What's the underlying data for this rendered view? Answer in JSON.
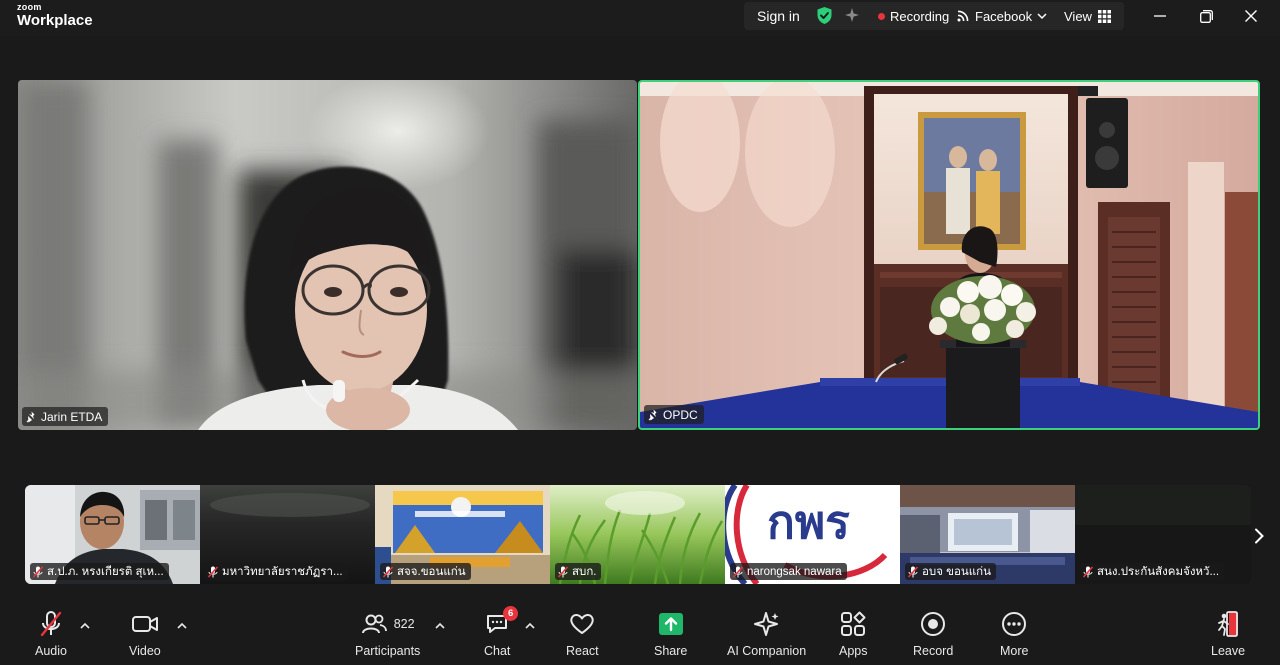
{
  "app": {
    "brand_top": "zoom",
    "brand_bottom": "Workplace"
  },
  "titlebar": {
    "signin": "Sign in",
    "recording": "Recording",
    "facebook": "Facebook",
    "view": "View"
  },
  "main_tiles": [
    {
      "name": "Jarin ETDA"
    },
    {
      "name": "OPDC",
      "active_speaker": true
    }
  ],
  "thumbnails": [
    {
      "name": "ส.ป.ภ. หรงเกียรติ สุเห..."
    },
    {
      "name": "มหาวิทยาลัยราชภัฏรา..."
    },
    {
      "name": "สจจ.ขอนแก่น"
    },
    {
      "name": "สบก."
    },
    {
      "name": "narongsak nawara"
    },
    {
      "name": "อบจ ขอนแก่น"
    },
    {
      "name": "สนง.ประกันสังคมจังหวั..."
    }
  ],
  "thumb_logo_text": "กพร",
  "toolbar": {
    "audio": "Audio",
    "video": "Video",
    "participants": "Participants",
    "participant_count": "822",
    "chat": "Chat",
    "chat_badge": "6",
    "react": "React",
    "share": "Share",
    "ai_companion": "AI Companion",
    "apps": "Apps",
    "record": "Record",
    "more": "More",
    "leave": "Leave"
  },
  "colors": {
    "active_border": "#3ed07a",
    "record_dot": "#e8343d",
    "share_green": "#1fb76a",
    "shield_green": "#2ad07a",
    "leave_red": "#e8343d"
  }
}
